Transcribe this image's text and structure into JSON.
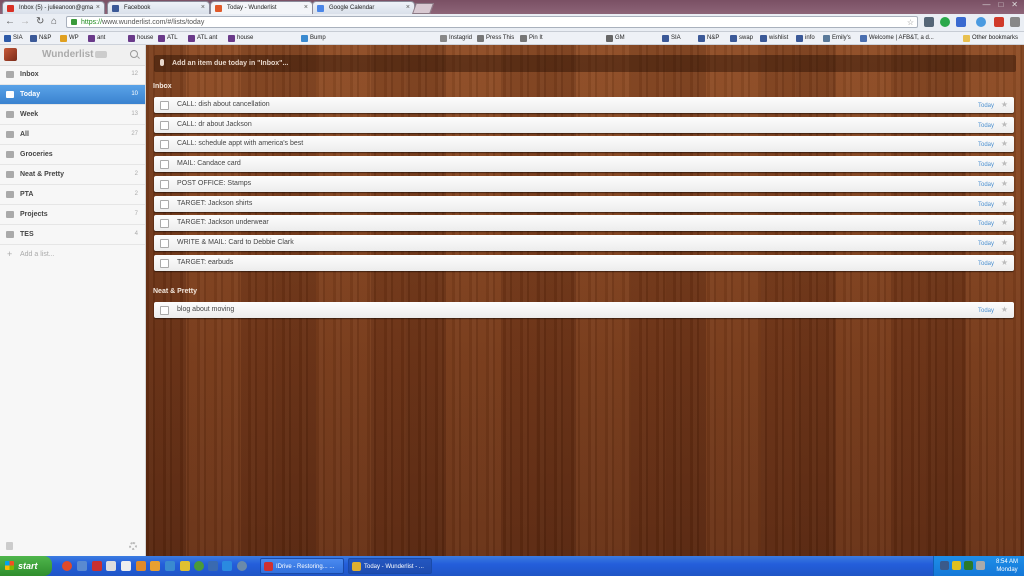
{
  "browser": {
    "tabs": [
      {
        "title": "Inbox (5) - julieanoon@gma",
        "fav_color": "#d93025"
      },
      {
        "title": "Facebook",
        "fav_color": "#3b5998"
      },
      {
        "title": "Today - Wunderlist",
        "fav_color": "#e05a2a"
      },
      {
        "title": "Google Calendar",
        "fav_color": "#4a86e8"
      }
    ],
    "url_scheme": "https://",
    "url_rest": "www.wunderlist.com/#/lists/today",
    "bookmarks": [
      {
        "label": "SIA",
        "color": "#2d5aa8"
      },
      {
        "label": "N&P",
        "color": "#3b5998"
      },
      {
        "label": "WP",
        "color": "#e0a020"
      },
      {
        "label": "ant",
        "color": "#6a3a8a"
      },
      {
        "label": "house",
        "color": "#6a3a8a"
      },
      {
        "label": "ATL",
        "color": "#6a3a8a"
      },
      {
        "label": "ATL ant",
        "color": "#6a3a8a"
      },
      {
        "label": "house",
        "color": "#6a3a8a"
      },
      {
        "label": "Bump",
        "color": "#3a8ad0"
      },
      {
        "label": "Instagrid",
        "color": "#888888"
      },
      {
        "label": "Press This",
        "color": "#777777"
      },
      {
        "label": "Pin It",
        "color": "#777777"
      },
      {
        "label": "GM",
        "color": "#666666"
      },
      {
        "label": "SIA",
        "color": "#3b5998"
      },
      {
        "label": "N&P",
        "color": "#3b5998"
      },
      {
        "label": "swap",
        "color": "#3b5998"
      },
      {
        "label": "wishlist",
        "color": "#3b5998"
      },
      {
        "label": "info",
        "color": "#3b5998"
      },
      {
        "label": "Emily's",
        "color": "#5a7a9a"
      },
      {
        "label": "Welcome | AFB&T, a d...",
        "color": "#4a6fb0"
      },
      {
        "label": "Other bookmarks",
        "color": "#e8c050"
      }
    ]
  },
  "app": {
    "brand": "Wunderlist",
    "lists": [
      {
        "label": "Inbox",
        "count": "12",
        "active": false
      },
      {
        "label": "Today",
        "count": "10",
        "active": true
      },
      {
        "label": "Week",
        "count": "13",
        "active": false
      },
      {
        "label": "All",
        "count": "27",
        "active": false
      },
      {
        "label": "Groceries",
        "count": "",
        "active": false
      },
      {
        "label": "Neat & Pretty",
        "count": "2",
        "active": false
      },
      {
        "label": "PTA",
        "count": "2",
        "active": false
      },
      {
        "label": "Projects",
        "count": "7",
        "active": false
      },
      {
        "label": "TES",
        "count": "4",
        "active": false
      }
    ],
    "add_list_label": "Add a list...",
    "add_item_placeholder": "Add an item due today in \"Inbox\"...",
    "sections": [
      {
        "name": "Inbox",
        "tasks": [
          {
            "title": "CALL: dish about cancellation",
            "due": "Today"
          },
          {
            "title": "CALL: dr about Jackson",
            "due": "Today"
          },
          {
            "title": "CALL: schedule appt with america's best",
            "due": "Today"
          },
          {
            "title": "MAIL: Candace card",
            "due": "Today"
          },
          {
            "title": "POST OFFICE: Stamps",
            "due": "Today"
          },
          {
            "title": "TARGET: Jackson shirts",
            "due": "Today"
          },
          {
            "title": "TARGET: Jackson underwear",
            "due": "Today"
          },
          {
            "title": "WRITE & MAIL: Card to Debbie Clark",
            "due": "Today"
          },
          {
            "title": "TARGET: earbuds",
            "due": "Today"
          }
        ]
      },
      {
        "name": "Neat & Pretty",
        "tasks": [
          {
            "title": "blog about moving",
            "due": "Today"
          }
        ]
      }
    ]
  },
  "taskbar": {
    "start_label": "start",
    "windows": [
      {
        "label": "IDrive - Restoring... ...",
        "color": "#d03030"
      },
      {
        "label": "Today - Wunderlist - ...",
        "color": "#e0b030"
      }
    ],
    "time": "8:54 AM",
    "day": "Monday"
  }
}
